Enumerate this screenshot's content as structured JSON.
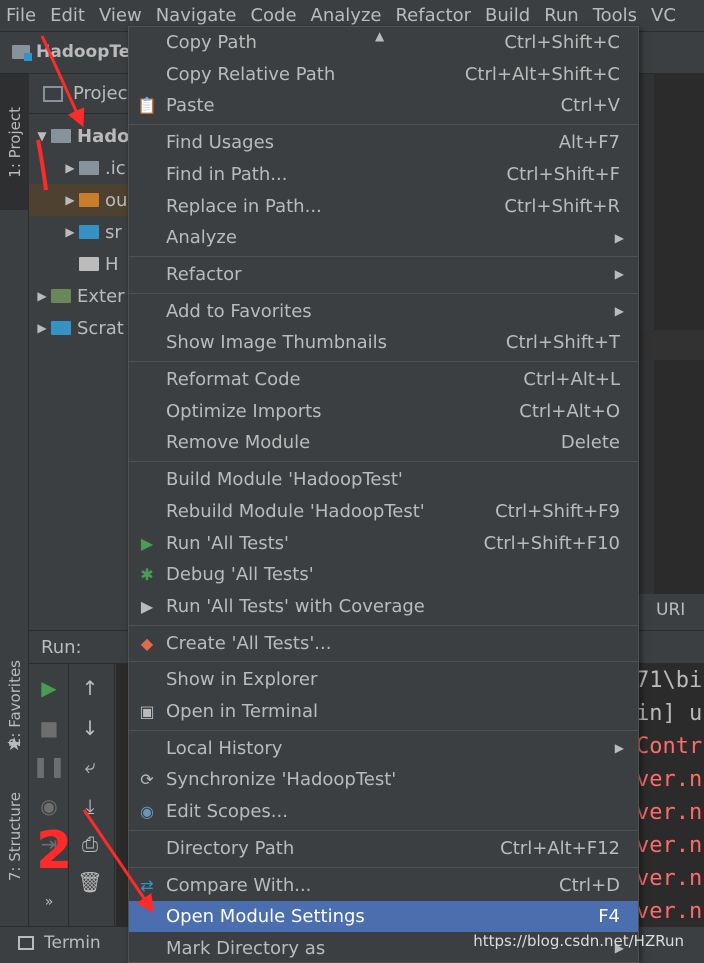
{
  "menubar": [
    "File",
    "Edit",
    "View",
    "Navigate",
    "Code",
    "Analyze",
    "Refactor",
    "Build",
    "Run",
    "Tools",
    "VC"
  ],
  "nav": {
    "project_name": "HadoopTe"
  },
  "left_strip": {
    "project_tab": "1: Project",
    "favorites_tab": "2: Favorites",
    "structure_tab": "7: Structure"
  },
  "project": {
    "header": "Project",
    "rows": [
      {
        "label": "Hado",
        "indent": 0,
        "expanded": true,
        "color": "#87939a"
      },
      {
        "label": ".ic",
        "indent": 1,
        "expanded": false,
        "color": "#87939a"
      },
      {
        "label": "ou",
        "indent": 1,
        "expanded": false,
        "color": "#c97c2c"
      },
      {
        "label": "sr",
        "indent": 1,
        "expanded": false,
        "color": "#3592c4"
      },
      {
        "label": "H",
        "indent": 1,
        "expanded": null,
        "color": "#bbbbbb"
      },
      {
        "label": "Exter",
        "indent": 0,
        "expanded": false,
        "color": "#6a8759"
      },
      {
        "label": "Scrat",
        "indent": 0,
        "expanded": false,
        "color": "#3592c4"
      }
    ]
  },
  "editor": {
    "uri_label": "URI"
  },
  "run": {
    "label": "Run:"
  },
  "console": {
    "lines": [
      {
        "text": "71\\bi",
        "color": "#bbbbbb"
      },
      {
        "text": "in] u",
        "color": "#bbbbbb"
      },
      {
        "text": "Contr",
        "color": "#ff6b68"
      },
      {
        "text": "ver.n",
        "color": "#ff6b68"
      },
      {
        "text": "ver.n",
        "color": "#ff6b68"
      },
      {
        "text": "ver.n",
        "color": "#ff6b68"
      },
      {
        "text": "ver.n",
        "color": "#ff6b68"
      },
      {
        "text": "ver.n",
        "color": "#ff6b68"
      }
    ]
  },
  "bottom": {
    "terminal": "Termin"
  },
  "context_menu": {
    "items": [
      {
        "label": "Copy Path",
        "shortcut": "Ctrl+Shift+C"
      },
      {
        "label": "Copy Relative Path",
        "shortcut": "Ctrl+Alt+Shift+C"
      },
      {
        "label": "Paste",
        "shortcut": "Ctrl+V",
        "icon": "paste-icon"
      },
      {
        "sep": true
      },
      {
        "label": "Find Usages",
        "shortcut": "Alt+F7"
      },
      {
        "label": "Find in Path...",
        "shortcut": "Ctrl+Shift+F"
      },
      {
        "label": "Replace in Path...",
        "shortcut": "Ctrl+Shift+R"
      },
      {
        "label": "Analyze",
        "submenu": true
      },
      {
        "sep": true
      },
      {
        "label": "Refactor",
        "submenu": true
      },
      {
        "sep": true
      },
      {
        "label": "Add to Favorites",
        "submenu": true
      },
      {
        "label": "Show Image Thumbnails",
        "shortcut": "Ctrl+Shift+T"
      },
      {
        "sep": true
      },
      {
        "label": "Reformat Code",
        "shortcut": "Ctrl+Alt+L"
      },
      {
        "label": "Optimize Imports",
        "shortcut": "Ctrl+Alt+O"
      },
      {
        "label": "Remove Module",
        "shortcut": "Delete"
      },
      {
        "sep": true
      },
      {
        "label": "Build Module 'HadoopTest'"
      },
      {
        "label": "Rebuild Module 'HadoopTest'",
        "shortcut": "Ctrl+Shift+F9"
      },
      {
        "label": "Run 'All Tests'",
        "shortcut": "Ctrl+Shift+F10",
        "icon": "run-icon"
      },
      {
        "label": "Debug 'All Tests'",
        "icon": "debug-icon"
      },
      {
        "label": "Run 'All Tests' with Coverage",
        "icon": "coverage-icon"
      },
      {
        "sep": true
      },
      {
        "label": "Create 'All Tests'...",
        "icon": "create-config-icon"
      },
      {
        "sep": true
      },
      {
        "label": "Show in Explorer"
      },
      {
        "label": "Open in Terminal",
        "icon": "terminal-icon"
      },
      {
        "sep": true
      },
      {
        "label": "Local History",
        "submenu": true
      },
      {
        "label": "Synchronize 'HadoopTest'",
        "icon": "sync-icon"
      },
      {
        "label": "Edit Scopes...",
        "icon": "scope-icon"
      },
      {
        "sep": true
      },
      {
        "label": "Directory Path",
        "shortcut": "Ctrl+Alt+F12"
      },
      {
        "sep": true
      },
      {
        "label": "Compare With...",
        "shortcut": "Ctrl+D",
        "icon": "compare-icon"
      },
      {
        "label": "Open Module Settings",
        "shortcut": "F4",
        "selected": true
      },
      {
        "label": "Mark Directory as",
        "submenu": true
      }
    ]
  },
  "annotation": {
    "step_number": "2",
    "arrow_color": "#ff2a2a"
  },
  "watermark": "https://blog.csdn.net/HZRun",
  "colors": {
    "selected": "#4b6eaf",
    "run_green": "#499c54",
    "error_red": "#ff6b68"
  }
}
